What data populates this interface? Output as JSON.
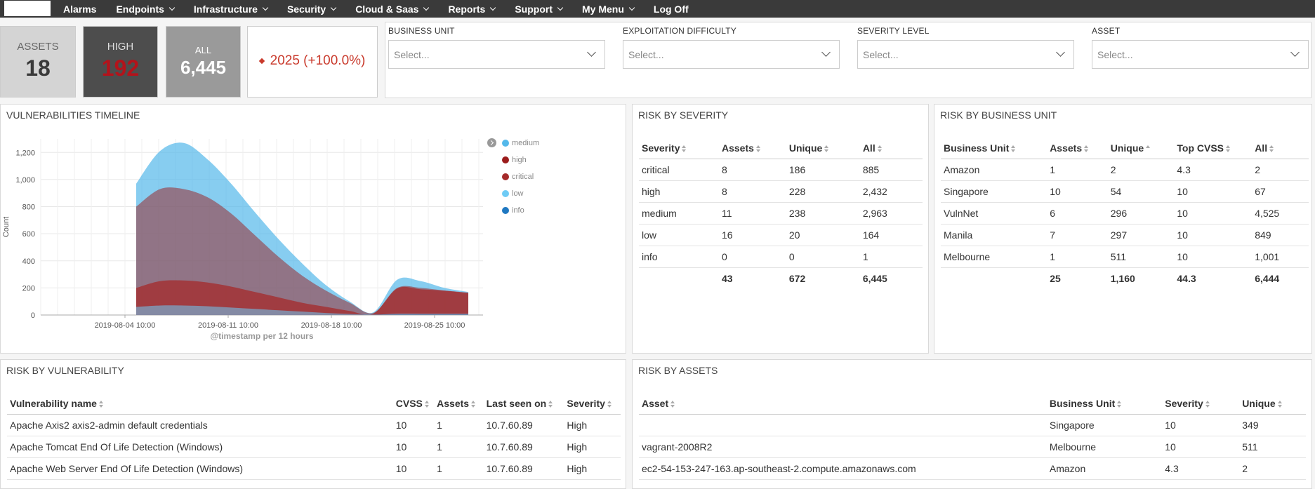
{
  "nav": {
    "items": [
      {
        "label": "Alarms",
        "dropdown": false
      },
      {
        "label": "Endpoints",
        "dropdown": true
      },
      {
        "label": "Infrastructure",
        "dropdown": true
      },
      {
        "label": "Security",
        "dropdown": true
      },
      {
        "label": "Cloud & Saas",
        "dropdown": true
      },
      {
        "label": "Reports",
        "dropdown": true
      },
      {
        "label": "Support",
        "dropdown": true
      },
      {
        "label": "My Menu",
        "dropdown": true
      },
      {
        "label": "Log Off",
        "dropdown": false
      }
    ]
  },
  "metrics": {
    "assets": {
      "label": "ASSETS",
      "value": "18"
    },
    "high": {
      "label": "HIGH",
      "value": "192"
    },
    "all": {
      "label": "ALL",
      "value": "6,445"
    },
    "trend": {
      "value": "2025 (+100.0%)"
    }
  },
  "filters": [
    {
      "label": "BUSINESS UNIT",
      "placeholder": "Select..."
    },
    {
      "label": "EXPLOITATION DIFFICULTY",
      "placeholder": "Select..."
    },
    {
      "label": "SEVERITY LEVEL",
      "placeholder": "Select..."
    },
    {
      "label": "ASSET",
      "placeholder": "Select..."
    }
  ],
  "timeline": {
    "title": "VULNERABILITIES TIMELINE",
    "ylabel": "Count",
    "xlabel": "@timestamp per 12 hours",
    "x_ticks": [
      "2019-08-04 10:00",
      "2019-08-11 10:00",
      "2019-08-18 10:00",
      "2019-08-25 10:00"
    ],
    "y_ticks": [
      "0",
      "200",
      "400",
      "600",
      "800",
      "1,000",
      "1,200"
    ],
    "legend": [
      {
        "label": "medium",
        "color": "#54b8ea"
      },
      {
        "label": "high",
        "color": "#9b1c1c"
      },
      {
        "label": "critical",
        "color": "#a52a2a"
      },
      {
        "label": "low",
        "color": "#6ecbf5"
      },
      {
        "label": "info",
        "color": "#1f78c1"
      }
    ]
  },
  "chart_data": {
    "type": "area",
    "title": "",
    "xlabel": "@timestamp per 12 hours",
    "ylabel": "Count",
    "ylim": [
      0,
      1300
    ],
    "x": [
      "2019-08-01 10:00",
      "2019-08-03 10:00",
      "2019-08-05 10:00",
      "2019-08-07 10:00",
      "2019-08-09 10:00",
      "2019-08-11 10:00",
      "2019-08-13 10:00",
      "2019-08-15 10:00",
      "2019-08-17 10:00",
      "2019-08-19 10:00",
      "2019-08-21 10:00",
      "2019-08-23 10:00",
      "2019-08-24 10:00",
      "2019-08-26 10:00",
      "2019-08-28 10:00"
    ],
    "stacked": false,
    "grid": true,
    "legend": "top-right",
    "series": [
      {
        "name": "medium",
        "color": "#54b8ea",
        "values": [
          970,
          1210,
          1270,
          1150,
          970,
          760,
          560,
          380,
          220,
          100,
          20,
          260,
          250,
          200,
          170
        ]
      },
      {
        "name": "high",
        "color": "#9b1c1c",
        "values": [
          800,
          930,
          930,
          870,
          750,
          590,
          430,
          290,
          180,
          90,
          15,
          200,
          200,
          180,
          160
        ]
      },
      {
        "name": "critical",
        "color": "#a52a2a",
        "values": [
          200,
          250,
          255,
          240,
          210,
          170,
          130,
          90,
          60,
          30,
          10,
          195,
          190,
          180,
          165
        ]
      },
      {
        "name": "low",
        "color": "#6ecbf5",
        "values": [
          60,
          70,
          70,
          65,
          55,
          45,
          35,
          25,
          15,
          8,
          3,
          10,
          10,
          10,
          10
        ]
      },
      {
        "name": "info",
        "color": "#1f78c1",
        "values": [
          0,
          0,
          0,
          0,
          0,
          0,
          0,
          0,
          0,
          0,
          0,
          1,
          1,
          1,
          1
        ]
      }
    ]
  },
  "severity_table": {
    "title": "RISK BY SEVERITY",
    "headers": [
      "Severity",
      "Assets",
      "Unique",
      "All"
    ],
    "rows": [
      [
        "critical",
        "8",
        "186",
        "885"
      ],
      [
        "high",
        "8",
        "228",
        "2,432"
      ],
      [
        "medium",
        "11",
        "238",
        "2,963"
      ],
      [
        "low",
        "16",
        "20",
        "164"
      ],
      [
        "info",
        "0",
        "0",
        "1"
      ]
    ],
    "total": [
      "",
      "43",
      "672",
      "6,445"
    ]
  },
  "business_table": {
    "title": "RISK BY BUSINESS UNIT",
    "headers": [
      "Business Unit",
      "Assets",
      "Unique",
      "Top CVSS",
      "All"
    ],
    "rows": [
      [
        "Amazon",
        "1",
        "2",
        "4.3",
        "2"
      ],
      [
        "Singapore",
        "10",
        "54",
        "10",
        "67"
      ],
      [
        "VulnNet",
        "6",
        "296",
        "10",
        "4,525"
      ],
      [
        "Manila",
        "7",
        "297",
        "10",
        "849"
      ],
      [
        "Melbourne",
        "1",
        "511",
        "10",
        "1,001"
      ]
    ],
    "total": [
      "",
      "25",
      "1,160",
      "44.3",
      "6,444"
    ]
  },
  "vuln_table": {
    "title": "RISK BY VULNERABILITY",
    "headers": [
      "Vulnerability name",
      "CVSS",
      "Assets",
      "Last seen on",
      "Severity"
    ],
    "rows": [
      [
        "Apache Axis2 axis2-admin default credentials",
        "10",
        "1",
        "10.7.60.89",
        "High"
      ],
      [
        "Apache Tomcat End Of Life Detection (Windows)",
        "10",
        "1",
        "10.7.60.89",
        "High"
      ],
      [
        "Apache Web Server End Of Life Detection (Windows)",
        "10",
        "1",
        "10.7.60.89",
        "High"
      ]
    ]
  },
  "assets_table": {
    "title": "RISK BY ASSETS",
    "headers": [
      "Asset",
      "Business Unit",
      "Severity",
      "Unique"
    ],
    "rows": [
      [
        "",
        "Singapore",
        "10",
        "349"
      ],
      [
        "vagrant-2008R2",
        "Melbourne",
        "10",
        "511"
      ],
      [
        "ec2-54-153-247-163.ap-southeast-2.compute.amazonaws.com",
        "Amazon",
        "4.3",
        "2"
      ]
    ]
  }
}
